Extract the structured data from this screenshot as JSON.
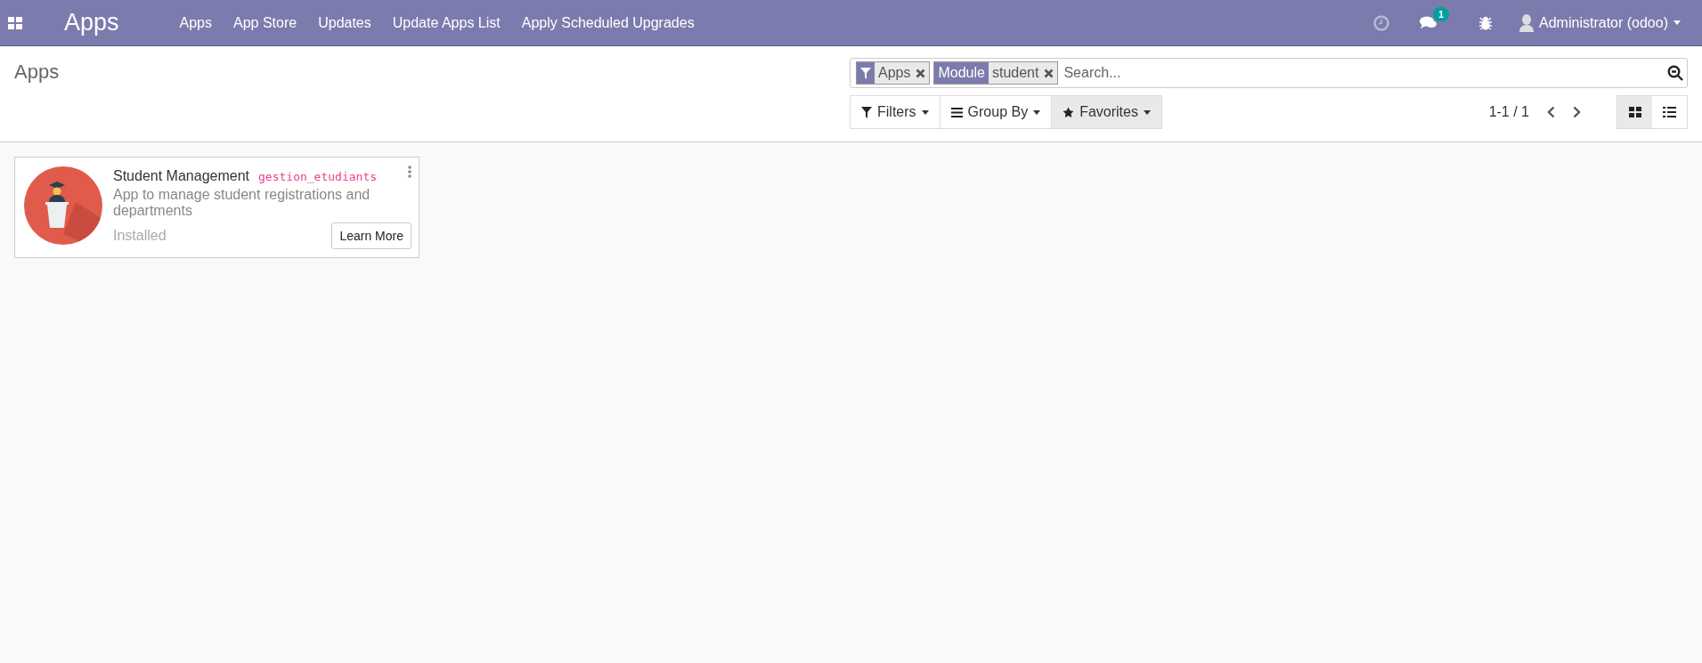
{
  "navbar": {
    "app_title": "Apps",
    "menu": [
      "Apps",
      "App Store",
      "Updates",
      "Update Apps List",
      "Apply Scheduled Upgrades"
    ],
    "messages_badge": "1",
    "user": "Administrator (odoo)"
  },
  "control_panel": {
    "breadcrumb": "Apps",
    "facets": [
      {
        "kind": "filter",
        "values": [
          "Apps"
        ]
      },
      {
        "kind": "field",
        "label": "Module",
        "values": [
          "student"
        ]
      }
    ],
    "search": {
      "placeholder": "Search..."
    },
    "buttons": [
      {
        "kind": "filter",
        "label": "Filters",
        "selected": false
      },
      {
        "kind": "groupby",
        "label": "Group By",
        "selected": false
      },
      {
        "kind": "favorite",
        "label": "Favorites",
        "selected": true
      }
    ],
    "pager": "1-1 / 1",
    "views": [
      {
        "kind": "kanban",
        "selected": true
      },
      {
        "kind": "list",
        "selected": false
      }
    ]
  },
  "cards": [
    {
      "name": "Student Management",
      "technical_name": "gestion_etudiants",
      "summary": "App to manage student registrations and departments",
      "status": "Installed",
      "button": "Learn More"
    }
  ]
}
